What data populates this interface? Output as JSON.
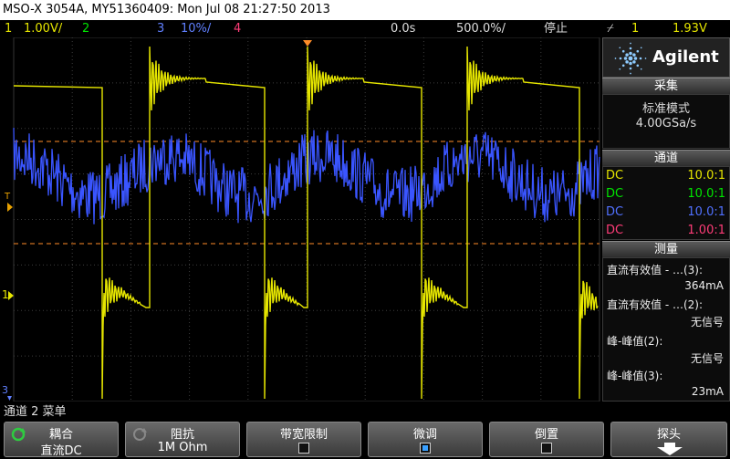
{
  "title": "MSO-X 3054A, MY51360409: Mon Jul 08 21:27:50 2013",
  "status": {
    "ch1_num": "1",
    "ch1_scale": "1.00V/",
    "ch2_num": "2",
    "ch3_num": "3",
    "ch3_scale": "10%/",
    "ch4_num": "4",
    "time_delay": "0.0s",
    "time_scale": "500.0%/",
    "run_state": "停止",
    "trig_symbol": "⌿",
    "trig_source": "1",
    "trig_level": "1.93V"
  },
  "markers": {
    "trigger": "T",
    "ch1": "1",
    "ch3": "3"
  },
  "panel": {
    "brand": "Agilent",
    "acq_header": "采集",
    "acq_mode": "标准模式",
    "acq_rate": "4.00GSa/s",
    "ch_header": "通道",
    "channels": [
      {
        "coupling": "DC",
        "ratio": "10.0:1",
        "color": "#e6e600"
      },
      {
        "coupling": "DC",
        "ratio": "10.0:1",
        "color": "#00e600"
      },
      {
        "coupling": "DC",
        "ratio": "10.0:1",
        "color": "#4060ff"
      },
      {
        "coupling": "DC",
        "ratio": "1.00:1",
        "color": "#ff3c78"
      }
    ],
    "meas_header": "测量",
    "measurements": [
      {
        "label": "直流有效值 - …(3):",
        "value": "364mA"
      },
      {
        "label": "直流有效值 - …(2):",
        "value": "无信号"
      },
      {
        "label": "峰-峰值(2):",
        "value": "无信号"
      },
      {
        "label": "峰-峰值(3):",
        "value": "23mA"
      }
    ]
  },
  "menu_title": "通道 2 菜单",
  "softkeys": [
    {
      "label": "耦合",
      "value": "直流DC"
    },
    {
      "label": "阻抗",
      "value": "1M Ohm"
    },
    {
      "label": "带宽限制",
      "value": ""
    },
    {
      "label": "微调",
      "value": ""
    },
    {
      "label": "倒置",
      "value": ""
    },
    {
      "label": "探头",
      "value": ""
    }
  ],
  "colors": {
    "ch1": "#e6e600",
    "ch2": "#00e600",
    "ch3": "#4060ff",
    "ch4": "#ff3c78",
    "cursor": "#ff8c28",
    "grid": "#505050"
  }
}
